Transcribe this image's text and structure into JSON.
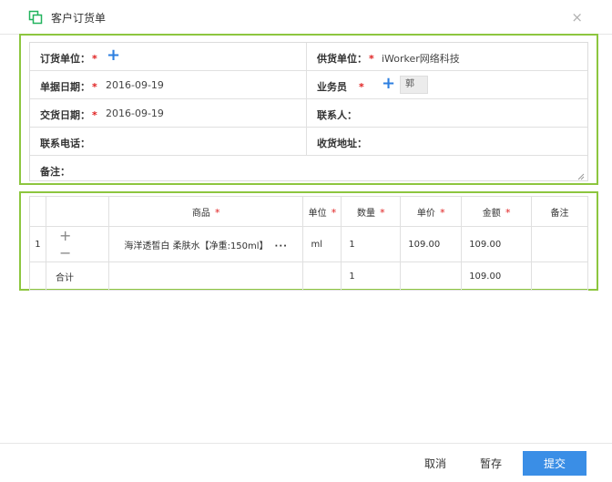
{
  "dialog": {
    "title": "客户订货单",
    "close_label": "×"
  },
  "form": {
    "order_unit_label": "订货单位：",
    "supplier_label": "供货单位：",
    "supplier_value": "iWorker网络科技",
    "doc_date_label": "单据日期：",
    "doc_date_value": "2016-09-19",
    "salesperson_label": "业务员",
    "salesperson_value": "郭",
    "delivery_date_label": "交货日期：",
    "delivery_date_value": "2016-09-19",
    "contact_label": "联系人：",
    "phone_label": "联系电话：",
    "address_label": "收货地址：",
    "remark_label": "备注：",
    "required_mark": "*",
    "add_icon": "+"
  },
  "table": {
    "headers": {
      "product": "商品",
      "unit": "单位",
      "qty": "数量",
      "price": "单价",
      "amount": "金额",
      "remark": "备注"
    },
    "rows": [
      {
        "index": "1",
        "add_icon": "+",
        "remove_icon": "−",
        "product": "海洋透皙白 柔肤水【净重:150ml】",
        "more": "···",
        "unit": "ml",
        "qty": "1",
        "price": "109.00",
        "amount": "109.00",
        "remark": ""
      }
    ],
    "total": {
      "label": "合计",
      "qty": "1",
      "amount": "109.00"
    }
  },
  "footer": {
    "cancel_label": "取消",
    "draft_label": "暂存",
    "submit_label": "提交"
  },
  "colors": {
    "accent": "#8dc63f",
    "primary": "#3a8ee6",
    "required": "#e02020"
  }
}
